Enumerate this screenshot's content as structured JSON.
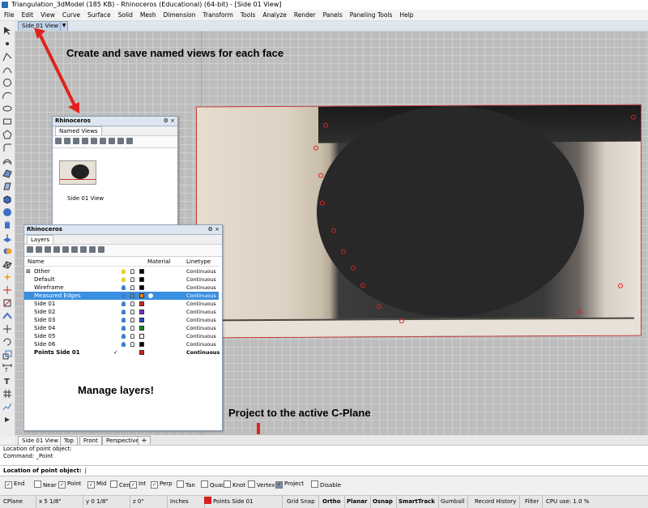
{
  "window": {
    "title": "Triangulation_3dModel (185 KB) - Rhinoceros (Educational) (64-bit) - [Side 01 View]"
  },
  "menu": [
    "File",
    "Edit",
    "View",
    "Curve",
    "Surface",
    "Solid",
    "Mesh",
    "Dimension",
    "Transform",
    "Tools",
    "Analyze",
    "Render",
    "Panels",
    "Paneling Tools",
    "Help"
  ],
  "viewport": {
    "tab_label": "Side 01 View",
    "dropdown_glyph": "▼"
  },
  "annotations": {
    "named_views": "Create and save named views for each face",
    "layers": "Manage layers!",
    "project": "Project to the active C-Plane"
  },
  "named_views_panel": {
    "header": "Rhinoceros",
    "header_buttons": "⚙ ×",
    "tab": "Named Views",
    "thumbnail_caption": "Side 01 View"
  },
  "layers_panel": {
    "header": "Rhinoceros",
    "header_buttons": "⚙ ×",
    "tab": "Layers",
    "columns": {
      "name": "Name",
      "material": "Material",
      "linetype": "Linetype"
    },
    "rows": [
      {
        "name": "Other",
        "color": "#000000",
        "linetype": "Continuous",
        "expander": "⊞"
      },
      {
        "name": "Default",
        "color": "#000000",
        "linetype": "Continuous"
      },
      {
        "name": "Wireframe",
        "color": "#000000",
        "linetype": "Continuous"
      },
      {
        "name": "Measured Edges",
        "color": "#ff8000",
        "linetype": "Continuous",
        "selected": true
      },
      {
        "name": "Side 01",
        "color": "#d42020",
        "linetype": "Continuous"
      },
      {
        "name": "Side 02",
        "color": "#7a2fd0",
        "linetype": "Continuous"
      },
      {
        "name": "Side 03",
        "color": "#2848c8",
        "linetype": "Continuous"
      },
      {
        "name": "Side 04",
        "color": "#1a8a2a",
        "linetype": "Continuous"
      },
      {
        "name": "Side 05",
        "color": "#ffffff",
        "linetype": "Continuous"
      },
      {
        "name": "Side 06",
        "color": "#000000",
        "linetype": "Continuous"
      },
      {
        "name": "Points Side 01",
        "color": "#d42020",
        "linetype": "Continuous",
        "current": true,
        "check": "✓"
      }
    ]
  },
  "bottom_tabs": [
    "Side 01 View",
    "Top",
    "Front",
    "Perspective"
  ],
  "bottom_tab_add": "✛",
  "command": {
    "history": [
      "Location of point object:",
      "Command: _Point"
    ],
    "prompt": "Location of point object:"
  },
  "osnaps": [
    {
      "label": "End",
      "checked": true
    },
    {
      "label": "Near",
      "checked": false
    },
    {
      "label": "Point",
      "checked": true
    },
    {
      "label": "Mid",
      "checked": true
    },
    {
      "label": "Cen",
      "checked": false
    },
    {
      "label": "Int",
      "checked": true
    },
    {
      "label": "Perp",
      "checked": true
    },
    {
      "label": "Tan",
      "checked": false
    },
    {
      "label": "Quad",
      "checked": false
    },
    {
      "label": "Knot",
      "checked": false
    },
    {
      "label": "Vertex",
      "checked": false
    },
    {
      "label": "Project",
      "checked": true,
      "highlight": true
    },
    {
      "label": "Disable",
      "checked": false
    }
  ],
  "check_glyph": "✓",
  "status": {
    "cplane": "CPlane",
    "x": "x 5 1/8\"",
    "y": "y 0 1/8\"",
    "z": "z 0\"",
    "units": "Inches",
    "layer": "Points Side 01",
    "layer_color": "#d42020",
    "grid_snap": "Grid Snap",
    "ortho": "Ortho",
    "planar": "Planar",
    "osnap": "Osnap",
    "smarttrack": "SmartTrack",
    "gumball": "Gumball",
    "record_history": "Record History",
    "filter": "Filter",
    "cpu": "CPU use: 1.0 %"
  }
}
